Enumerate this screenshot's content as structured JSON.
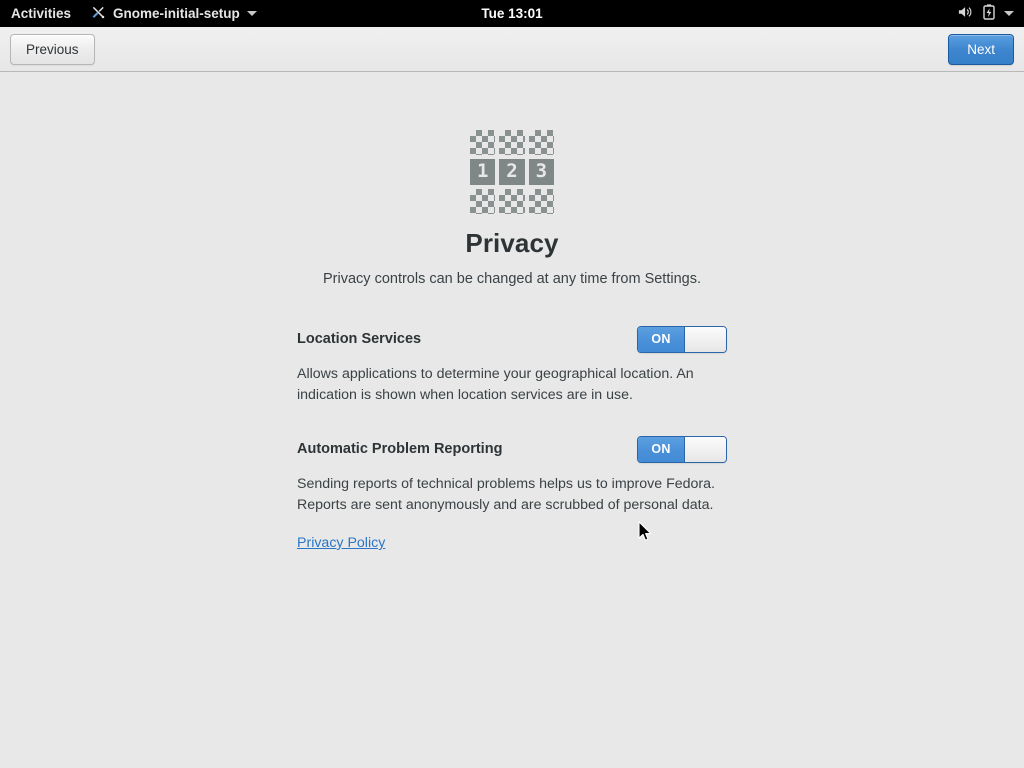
{
  "topbar": {
    "activities_label": "Activities",
    "app_name": "Gnome-initial-setup",
    "app_icon": "crossed-tools-icon",
    "clock": "Tue 13:01",
    "status_icons": [
      "volume-speaker-icon",
      "battery-charging-icon",
      "chevron-down-icon"
    ]
  },
  "headerbar": {
    "previous_label": "Previous",
    "next_label": "Next",
    "accent_color": "#3e86cf"
  },
  "page": {
    "icon": {
      "name": "gnome-initial-setup-123-icon",
      "numbers": [
        "1",
        "2",
        "3"
      ],
      "tile_color": "#7f8787",
      "checker_color": "#8a9191"
    },
    "title": "Privacy",
    "subtitle": "Privacy controls can be changed at any time from Settings."
  },
  "options": [
    {
      "label": "Location Services",
      "toggle_state": "ON",
      "description": "Allows applications to determine your geographical location. An indication is shown when location services are in use."
    },
    {
      "label": "Automatic Problem Reporting",
      "toggle_state": "ON",
      "description": "Sending reports of technical problems helps us to improve Fedora. Reports are sent anonymously and are scrubbed of personal data."
    }
  ],
  "link": {
    "privacy_policy_label": "Privacy Policy",
    "color": "#2a76c6"
  }
}
